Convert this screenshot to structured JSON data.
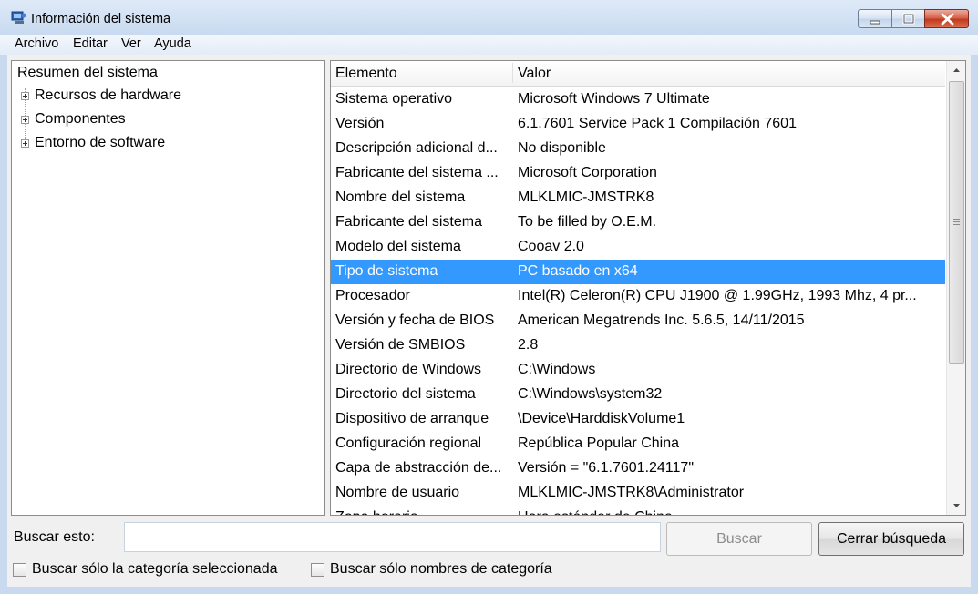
{
  "window": {
    "title": "Información del sistema"
  },
  "menu": [
    "Archivo",
    "Editar",
    "Ver",
    "Ayuda"
  ],
  "tree": {
    "root": "Resumen del sistema",
    "nodes": [
      "Recursos de hardware",
      "Componentes",
      "Entorno de software"
    ]
  },
  "list": {
    "columns": [
      "Elemento",
      "Valor"
    ],
    "rows": [
      [
        "Sistema operativo",
        "Microsoft Windows 7 Ultimate"
      ],
      [
        "Versión",
        "6.1.7601 Service Pack 1 Compilación 7601"
      ],
      [
        "Descripción adicional d...",
        "No disponible"
      ],
      [
        "Fabricante del sistema ...",
        "Microsoft Corporation"
      ],
      [
        "Nombre del sistema",
        "MLKLMIC-JMSTRK8"
      ],
      [
        "Fabricante del sistema",
        "To be filled by O.E.M."
      ],
      [
        "Modelo del sistema",
        "Cooav 2.0"
      ],
      [
        "Tipo de sistema",
        "PC basado en x64"
      ],
      [
        "Procesador",
        "Intel(R) Celeron(R) CPU  J1900  @ 1.99GHz, 1993 Mhz, 4 pr..."
      ],
      [
        "Versión y fecha de BIOS",
        "American Megatrends Inc. 5.6.5, 14/11/2015"
      ],
      [
        "Versión de SMBIOS",
        "2.8"
      ],
      [
        "Directorio de Windows",
        "C:\\Windows"
      ],
      [
        "Directorio del sistema",
        "C:\\Windows\\system32"
      ],
      [
        "Dispositivo de arranque",
        "\\Device\\HarddiskVolume1"
      ],
      [
        "Configuración regional",
        "República Popular China"
      ],
      [
        "Capa de abstracción de...",
        "Versión = \"6.1.7601.24117\""
      ],
      [
        "Nombre de usuario",
        "MLKLMIC-JMSTRK8\\Administrator"
      ],
      [
        "Zona horaria",
        "Hora estándar de China"
      ]
    ],
    "selected_row": 7
  },
  "search": {
    "label": "Buscar esto:",
    "value": "",
    "search_button": "Buscar",
    "close_button": "Cerrar búsqueda",
    "check_selected_category": "Buscar sólo la categoría seleccionada",
    "check_category_names": "Buscar sólo nombres de categoría"
  },
  "colors": {
    "selection": "#3399ff",
    "titlebar": "#c8daf0"
  }
}
